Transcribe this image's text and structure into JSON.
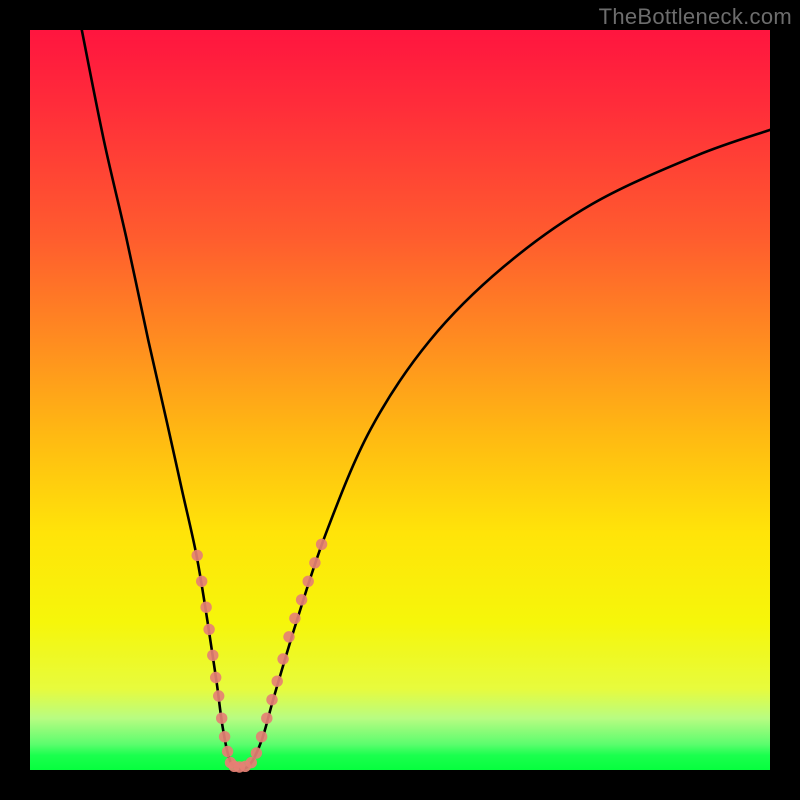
{
  "watermark": "TheBottleneck.com",
  "colors": {
    "background": "#000000",
    "curve": "#000000",
    "marker_fill": "#e58074",
    "gradient_top": "#ff153f",
    "gradient_bottom": "#06ff3e"
  },
  "chart_data": {
    "type": "line",
    "title": "",
    "xlabel": "",
    "ylabel": "",
    "xlim": [
      0,
      100
    ],
    "ylim": [
      0,
      100
    ],
    "grid": false,
    "series": [
      {
        "name": "curve",
        "x": [
          7,
          10,
          13,
          16,
          18.5,
          20.5,
          22.5,
          24,
          25.2,
          26,
          26.8,
          27.6,
          29.5,
          31.3,
          33,
          36,
          40,
          46,
          54,
          64,
          76,
          90,
          100
        ],
        "y": [
          100,
          85,
          72,
          58,
          47,
          38,
          29,
          20,
          12,
          6,
          2,
          0.5,
          0.5,
          4,
          10,
          20,
          32,
          46,
          58,
          68,
          76.5,
          83,
          86.5
        ]
      }
    ],
    "markers": {
      "name": "highlighted-points",
      "color": "#e58074",
      "points": [
        {
          "x": 22.6,
          "y": 29.0,
          "r": 1.2
        },
        {
          "x": 23.2,
          "y": 25.5,
          "r": 1.2
        },
        {
          "x": 23.8,
          "y": 22.0,
          "r": 1.2
        },
        {
          "x": 24.2,
          "y": 19.0,
          "r": 1.2
        },
        {
          "x": 24.7,
          "y": 15.5,
          "r": 1.2
        },
        {
          "x": 25.1,
          "y": 12.5,
          "r": 1.2
        },
        {
          "x": 25.5,
          "y": 10.0,
          "r": 1.2
        },
        {
          "x": 25.9,
          "y": 7.0,
          "r": 1.2
        },
        {
          "x": 26.3,
          "y": 4.5,
          "r": 1.2
        },
        {
          "x": 26.7,
          "y": 2.5,
          "r": 1.2
        },
        {
          "x": 27.1,
          "y": 1.0,
          "r": 1.2
        },
        {
          "x": 27.6,
          "y": 0.5,
          "r": 1.2
        },
        {
          "x": 28.3,
          "y": 0.4,
          "r": 1.2
        },
        {
          "x": 29.1,
          "y": 0.5,
          "r": 1.2
        },
        {
          "x": 29.9,
          "y": 1.0,
          "r": 1.2
        },
        {
          "x": 30.6,
          "y": 2.3,
          "r": 1.2
        },
        {
          "x": 31.3,
          "y": 4.5,
          "r": 1.2
        },
        {
          "x": 32.0,
          "y": 7.0,
          "r": 1.2
        },
        {
          "x": 32.7,
          "y": 9.5,
          "r": 1.2
        },
        {
          "x": 33.4,
          "y": 12.0,
          "r": 1.2
        },
        {
          "x": 34.2,
          "y": 15.0,
          "r": 1.2
        },
        {
          "x": 35.0,
          "y": 18.0,
          "r": 1.2
        },
        {
          "x": 35.8,
          "y": 20.5,
          "r": 1.2
        },
        {
          "x": 36.7,
          "y": 23.0,
          "r": 1.2
        },
        {
          "x": 37.6,
          "y": 25.5,
          "r": 1.2
        },
        {
          "x": 38.5,
          "y": 28.0,
          "r": 1.2
        },
        {
          "x": 39.4,
          "y": 30.5,
          "r": 1.2
        }
      ]
    }
  }
}
